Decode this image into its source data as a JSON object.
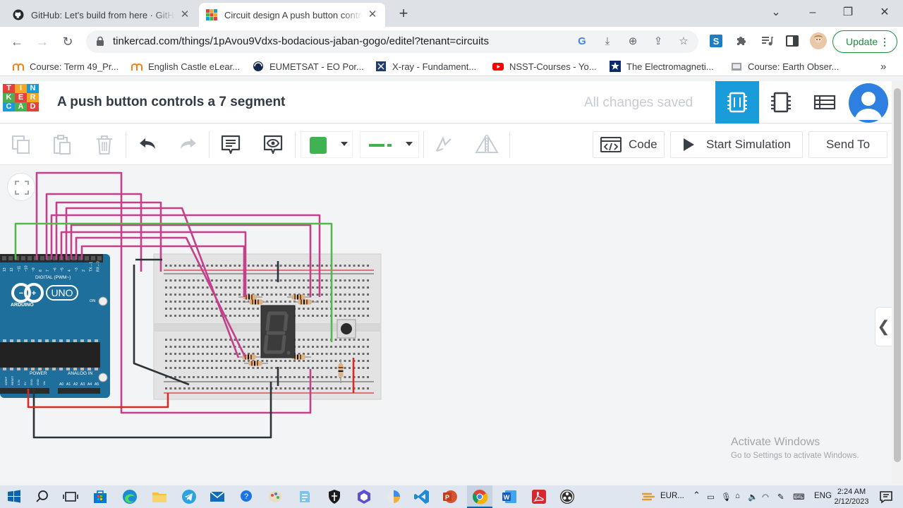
{
  "browser": {
    "tabs": [
      {
        "title": "GitHub: Let's build from here · GitHub",
        "active": false
      },
      {
        "title": "Circuit design A push button controls a 7 segment",
        "active": true
      }
    ],
    "new_tab_icon": "plus-icon",
    "address": "tinkercad.com/things/1pAvou9Vdxs-bodacious-jaban-gogo/editel?tenant=circuits",
    "update_label": "Update",
    "bookmarks": [
      {
        "label": "Course: Term 49_Pr...",
        "icon": "moodle-icon"
      },
      {
        "label": "English Castle eLear...",
        "icon": "moodle-icon"
      },
      {
        "label": "EUMETSAT - EO Por...",
        "icon": "eumetsat-icon"
      },
      {
        "label": "X-ray - Fundament...",
        "icon": "xray-icon"
      },
      {
        "label": "NSST-Courses - Yo...",
        "icon": "youtube-icon"
      },
      {
        "label": "The Electromagneti...",
        "icon": "star-icon"
      },
      {
        "label": "Course: Earth Obser...",
        "icon": "course-icon"
      }
    ],
    "more_bookmarks": "»"
  },
  "tinkercad": {
    "logo_letters": [
      "T",
      "I",
      "N",
      "K",
      "E",
      "R",
      "C",
      "A",
      "D"
    ],
    "design_title": "A push button controls a 7 segment",
    "save_status": "All changes saved",
    "toolbar": {
      "code_label": "Code",
      "simulate_label": "Start Simulation",
      "send_label": "Send To",
      "wire_color": "#3fb34f"
    },
    "board": {
      "name": "UNO",
      "brand": "ARDUINO",
      "digital_label": "DIGITAL (PWM~)",
      "power_label": "POWER",
      "analog_label": "ANALOG IN",
      "on_label": "ON",
      "digital_pins": [
        "13",
        "12",
        "~11",
        "~10",
        "~9",
        "8",
        "7",
        "~6",
        "~5",
        "4",
        "~3",
        "2",
        "TX→1",
        "RX←0"
      ],
      "analog_pins": [
        "A0",
        "A1",
        "A2",
        "A3",
        "A4",
        "A5"
      ],
      "power_pins": [
        "IOREF",
        "RESET",
        "3.3V",
        "5V",
        "GND",
        "GND",
        "Vin"
      ]
    },
    "display_digit": "8"
  },
  "watermark": {
    "line1": "Activate Windows",
    "line2": "Go to Settings to activate Windows."
  },
  "taskbar": {
    "weather": "EUR...",
    "lang": "ENG",
    "time": "2:24 AM",
    "date": "2/12/2023"
  },
  "colors": {
    "tinkercad_blue": "#1a9cdb",
    "wire_magenta": "#c2408c",
    "wire_green": "#56b84a",
    "wire_black": "#2c3338",
    "wire_red": "#d62b2b",
    "arduino_teal": "#1c6f9c"
  }
}
